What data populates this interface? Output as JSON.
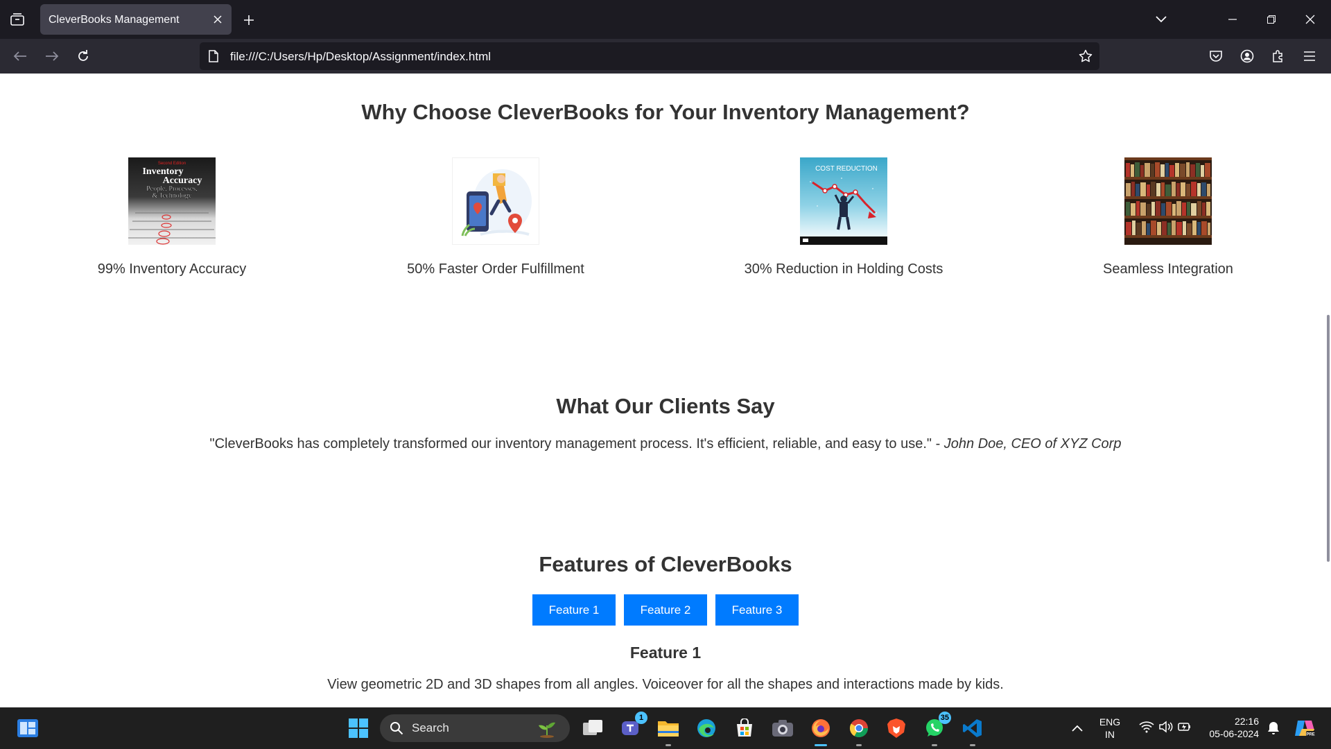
{
  "browser": {
    "tab_title": "CleverBooks Management",
    "url": "file:///C:/Users/Hp/Desktop/Assignment/index.html"
  },
  "why_section": {
    "heading": "Why Choose CleverBooks for Your Inventory Management?",
    "benefits": [
      {
        "label": "99% Inventory Accuracy",
        "image": "inventory-accuracy-book-cover",
        "image_text": [
          "Second Edition",
          "Inventory",
          "Accuracy",
          "People, Processes,",
          "& Technology"
        ]
      },
      {
        "label": "50% Faster Order Fulfillment",
        "image": "delivery-illustration"
      },
      {
        "label": "30% Reduction in Holding Costs",
        "image": "cost-reduction-chart",
        "image_text": [
          "COST REDUCTION"
        ]
      },
      {
        "label": "Seamless Integration",
        "image": "bookshelf"
      }
    ]
  },
  "clients_section": {
    "heading": "What Our Clients Say",
    "quote": "\"CleverBooks has completely transformed our inventory management process. It's efficient, reliable, and easy to use.\"",
    "separator": " - ",
    "author": "John Doe, CEO of XYZ Corp"
  },
  "features_section": {
    "heading": "Features of CleverBooks",
    "tabs": [
      "Feature 1",
      "Feature 2",
      "Feature 3"
    ],
    "active_title": "Feature 1",
    "active_description": "View geometric 2D and 3D shapes from all angles. Voiceover for all the shapes and interactions made by kids."
  },
  "taskbar": {
    "search_placeholder": "Search",
    "teams_badge": "1",
    "whatsapp_badge": "35",
    "language": "ENG",
    "region": "IN",
    "time": "22:16",
    "date": "05-06-2024"
  },
  "colors": {
    "accent_button": "#007bff",
    "page_background": "#ffffff",
    "text": "#333333",
    "browser_chrome": "#1c1b22"
  }
}
